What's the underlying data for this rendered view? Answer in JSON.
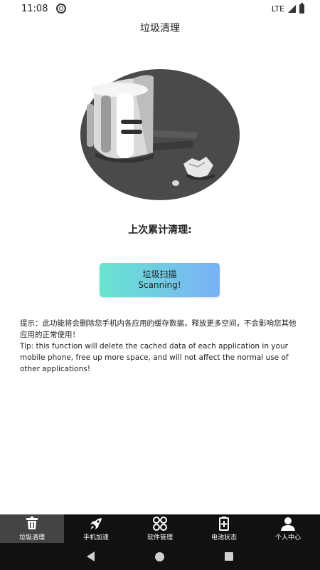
{
  "status_bar": {
    "time": "11:08",
    "network": "LTE"
  },
  "header": {
    "title": "垃圾清理"
  },
  "summary": {
    "label": "上次累计清理:"
  },
  "scan_button": {
    "line1": "垃圾扫描",
    "line2": "Scanning!"
  },
  "tips": {
    "chinese": "提示：此功能将会删除您手机内各应用的缓存数据，释放更多空间，不会影响您其他应用的正常使用！",
    "english": "Tip: this function will delete the cached data of each application in your mobile phone, free up more space, and will not affect the normal use of other applications!"
  },
  "bottom_nav": {
    "items": [
      {
        "label": "垃圾清理",
        "icon": "trash-icon",
        "active": true
      },
      {
        "label": "手机加速",
        "icon": "rocket-icon",
        "active": false
      },
      {
        "label": "软件管理",
        "icon": "apps-icon",
        "active": false
      },
      {
        "label": "电池状态",
        "icon": "battery-icon",
        "active": false
      },
      {
        "label": "个人中心",
        "icon": "person-icon",
        "active": false
      }
    ]
  },
  "colors": {
    "button_gradient_start": "#68e5d0",
    "button_gradient_end": "#7ab1f7",
    "nav_background": "#111111",
    "nav_active": "#444444"
  }
}
